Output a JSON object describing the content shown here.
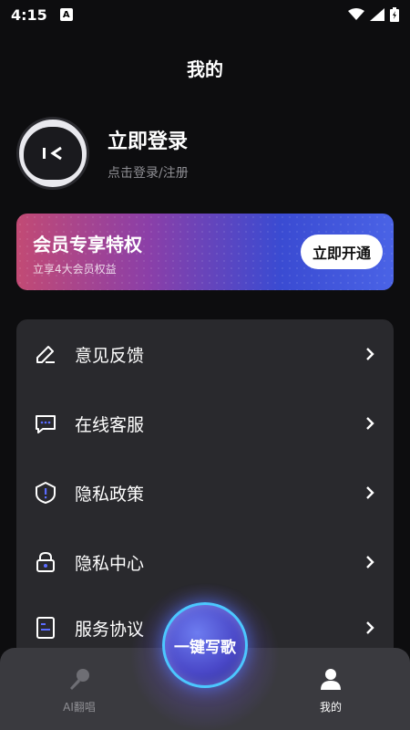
{
  "status_bar": {
    "time": "4:15",
    "notification_letter": "A"
  },
  "header": {
    "title": "我的"
  },
  "profile": {
    "login_title": "立即登录",
    "login_subtitle": "点击登录/注册"
  },
  "vip": {
    "title": "会员专享特权",
    "subtitle": "立享4大会员权益",
    "button_label": "立即开通"
  },
  "menu": {
    "items": [
      {
        "label": "意见反馈",
        "icon": "edit-icon"
      },
      {
        "label": "在线客服",
        "icon": "chat-icon"
      },
      {
        "label": "隐私政策",
        "icon": "shield-icon"
      },
      {
        "label": "隐私中心",
        "icon": "lock-icon"
      },
      {
        "label": "服务协议",
        "icon": "document-icon"
      }
    ]
  },
  "bottom_nav": {
    "center_button_label": "一键写歌",
    "tabs": [
      {
        "label": "AI翻唱",
        "icon": "microphone-icon",
        "active": false
      },
      {
        "label": "我的",
        "icon": "user-icon",
        "active": true
      }
    ]
  },
  "colors": {
    "background": "#0d0d0f",
    "menu_bg": "#29292d",
    "accent_blue": "#4a63e6",
    "accent_pink": "#c24a74"
  }
}
